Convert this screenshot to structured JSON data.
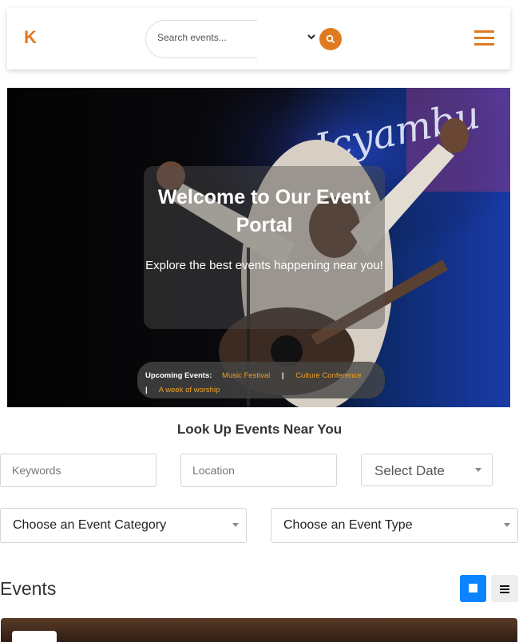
{
  "header": {
    "logo": "K",
    "search_placeholder": "Search events...",
    "icons": {
      "dropdown": "chevron-down-icon",
      "search": "search-icon",
      "menu": "hamburger-menu-icon"
    },
    "accent": "#e07a1f"
  },
  "hero": {
    "title": "Welcome to Our Event Portal",
    "subtitle": "Explore the best events happening near you!",
    "upcoming_label": "Upcoming Events:",
    "upcoming_events": [
      "Music Festival",
      "Culture Conference",
      "A week of worship"
    ],
    "event_link_color": "#f0a020",
    "separator": "|"
  },
  "lookup": {
    "title": "Look Up Events Near You",
    "keywords_placeholder": "Keywords",
    "location_placeholder": "Location",
    "date_label": "Select Date",
    "category_label": "Choose an Event Category",
    "type_label": "Choose an Event Type"
  },
  "events": {
    "title": "Events",
    "view_icons": [
      "grid-view-icon",
      "list-view-icon"
    ],
    "active_view_color": "#0a84ff"
  }
}
